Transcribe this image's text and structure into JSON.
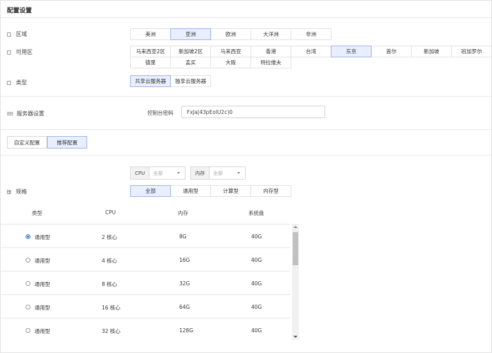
{
  "page": {
    "title": "配置设置"
  },
  "region": {
    "label": "区域",
    "options": [
      "美洲",
      "亚洲",
      "欧洲",
      "大洋洲",
      "非洲"
    ],
    "selected": "亚洲"
  },
  "zone": {
    "label": "可用区",
    "options": [
      "马来西亚2区",
      "新加坡2区",
      "马来西亚",
      "香港",
      "台湾",
      "东京",
      "首尔",
      "新加坡",
      "班加罗尔",
      "德里",
      "孟买",
      "大阪",
      "特拉维夫"
    ],
    "selected": "东京"
  },
  "type": {
    "label": "类型",
    "options": [
      "共享云服务器",
      "独享云服务器"
    ],
    "selected": "共享云服务器"
  },
  "server": {
    "label": "服务器设置",
    "password_label": "控制台密码",
    "password_value": "FxJa|43pEoIU2c)0"
  },
  "config_tabs": {
    "items": [
      "自定义配置",
      "推荐配置"
    ],
    "selected": "推荐配置"
  },
  "spec": {
    "label": "规格",
    "cpu_filter": {
      "label": "CPU",
      "value": "全部"
    },
    "mem_filter": {
      "label": "内存",
      "value": "全部"
    },
    "categories": [
      "全部",
      "通用型",
      "计算型",
      "内存型"
    ],
    "selected_category": "全部"
  },
  "table": {
    "headers": [
      "类型",
      "CPU",
      "内存",
      "系统盘"
    ],
    "rows": [
      {
        "type": "通用型",
        "cpu": "2 核心",
        "mem": "8G",
        "disk": "40G",
        "selected": true
      },
      {
        "type": "通用型",
        "cpu": "4 核心",
        "mem": "16G",
        "disk": "40G",
        "selected": false
      },
      {
        "type": "通用型",
        "cpu": "8 核心",
        "mem": "32G",
        "disk": "40G",
        "selected": false
      },
      {
        "type": "通用型",
        "cpu": "16 核心",
        "mem": "64G",
        "disk": "40G",
        "selected": false
      },
      {
        "type": "通用型",
        "cpu": "32 核心",
        "mem": "128G",
        "disk": "40G",
        "selected": false
      }
    ]
  },
  "colors": {
    "accent": "#3a6fd8",
    "selected_bg": "#e9efff",
    "border": "#e2e2e2"
  }
}
